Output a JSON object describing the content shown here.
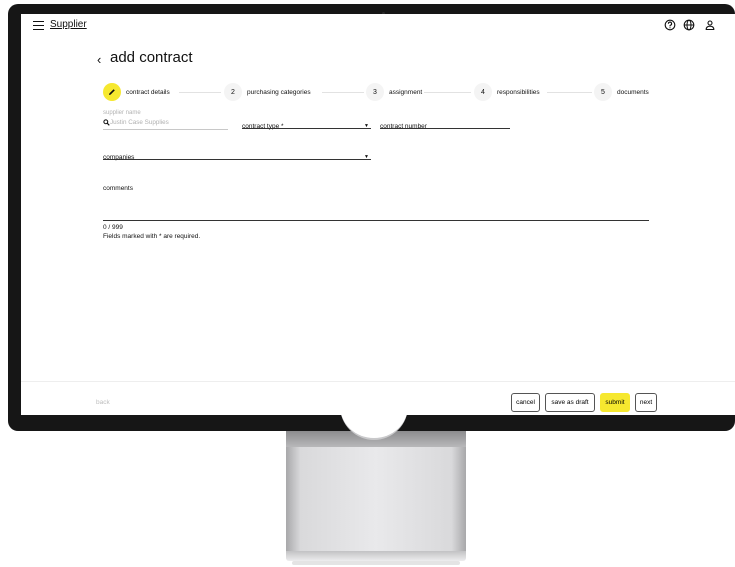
{
  "app": {
    "title": "Supplier",
    "icons": [
      "menu-icon",
      "help-icon",
      "globe-icon",
      "user-icon"
    ]
  },
  "page": {
    "back_symbol": "‹",
    "title": "add contract"
  },
  "stepper": {
    "steps": [
      {
        "marker": "",
        "label": "contract details",
        "active": true
      },
      {
        "marker": "2",
        "label": "purchasing categories",
        "active": false
      },
      {
        "marker": "3",
        "label": "assignment",
        "active": false
      },
      {
        "marker": "4",
        "label": "responsibilities",
        "active": false
      },
      {
        "marker": "5",
        "label": "documents",
        "active": false
      }
    ]
  },
  "form": {
    "supplier": {
      "label": "supplier name",
      "placeholder": "Justin Case Supplies"
    },
    "contract_type": {
      "label": "contract type *"
    },
    "contract_number": {
      "label": "contract number"
    },
    "companies": {
      "label": "companies"
    },
    "comments": {
      "label": "comments",
      "counter": "0 / 999"
    },
    "required_note": "Fields marked with * are required."
  },
  "footer": {
    "back_label": "back",
    "cancel_label": "cancel",
    "draft_label": "save as draft",
    "submit_label": "submit",
    "next_label": "next"
  },
  "colors": {
    "accent": "#f6e82f",
    "text": "#111111",
    "muted": "#b3b3b3",
    "bezel": "#161616"
  }
}
